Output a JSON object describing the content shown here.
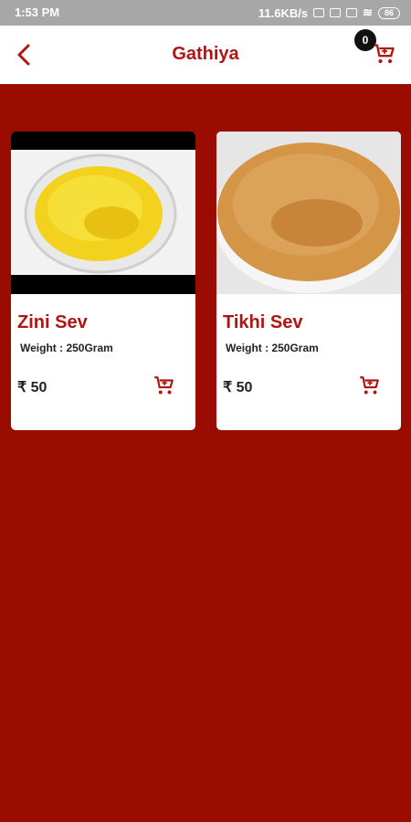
{
  "status": {
    "time": "1:53 PM",
    "speed": "11.6KB/s",
    "battery": "86"
  },
  "header": {
    "title": "Gathiya",
    "cart_count": "0"
  },
  "products": [
    {
      "name": "Zini Sev",
      "weight": "Weight : 250Gram",
      "price": "₹ 50"
    },
    {
      "name": "Tikhi Sev",
      "weight": "Weight : 250Gram",
      "price": "₹ 50"
    }
  ],
  "colors": {
    "primary": "#9b0c00",
    "title_red": "#b01512",
    "statusbar": "#a7a7a7"
  }
}
